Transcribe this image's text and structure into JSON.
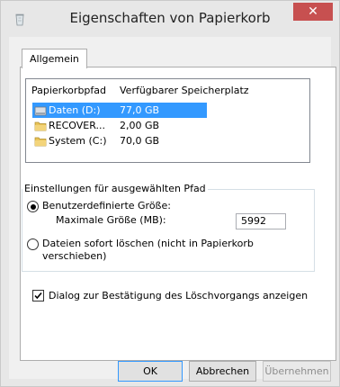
{
  "window": {
    "title": "Eigenschaften von Papierkorb",
    "close_glyph": "✕"
  },
  "tabs": [
    {
      "label": "Allgemein",
      "active": true
    }
  ],
  "list": {
    "headers": [
      "Papierkorbpfad",
      "Verfügbarer Speicherplatz"
    ],
    "rows": [
      {
        "name": "Daten (D:)",
        "size": "77,0 GB",
        "selected": true,
        "icon": "drive-icon"
      },
      {
        "name": "RECOVER...",
        "size": "2,00 GB",
        "selected": false,
        "icon": "drive-icon"
      },
      {
        "name": "System (C:)",
        "size": "70,0 GB",
        "selected": false,
        "icon": "drive-icon"
      }
    ]
  },
  "settings": {
    "legend": "Einstellungen für ausgewählten Pfad",
    "custom_size_label": "Benutzerdefinierte Größe:",
    "max_size_label": "Maximale Größe (MB):",
    "max_size_value": "5992",
    "delete_immediately_line1": "Dateien sofort löschen (nicht in Papierkorb",
    "delete_immediately_line2": "verschieben)",
    "selected_option": "custom"
  },
  "confirm": {
    "label": "Dialog zur Bestätigung des Löschvorgangs anzeigen",
    "checked": true
  },
  "buttons": {
    "ok": "OK",
    "cancel": "Abbrechen",
    "apply": "Übernehmen"
  },
  "colors": {
    "selection": "#3399ff",
    "close": "#c75050"
  }
}
